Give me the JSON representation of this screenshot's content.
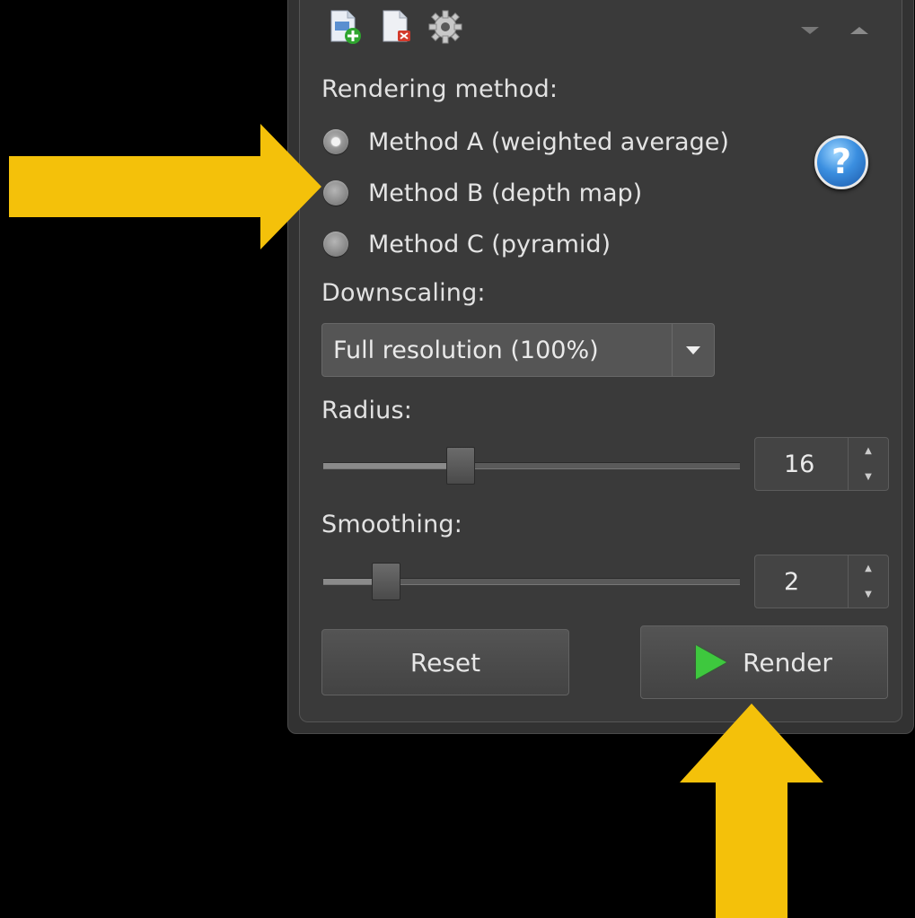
{
  "toolbar": {
    "icons": [
      "add-document-icon",
      "remove-document-icon",
      "settings-gear-icon"
    ]
  },
  "rendering": {
    "title": "Rendering method:",
    "options": [
      {
        "label": "Method A (weighted average)",
        "checked": true
      },
      {
        "label": "Method B (depth map)",
        "checked": false
      },
      {
        "label": "Method C (pyramid)",
        "checked": false
      }
    ],
    "help_symbol": "?"
  },
  "downscaling": {
    "title": "Downscaling:",
    "value": "Full resolution (100%)"
  },
  "radius": {
    "title": "Radius:",
    "value": "16",
    "slider_fraction": 0.33
  },
  "smoothing": {
    "title": "Smoothing:",
    "value": "2",
    "slider_fraction": 0.15
  },
  "buttons": {
    "reset": "Reset",
    "render": "Render"
  },
  "colors": {
    "annotation_arrow": "#f4c10a",
    "play_icon": "#3ec83e",
    "help_icon": "#3b8fe0"
  }
}
